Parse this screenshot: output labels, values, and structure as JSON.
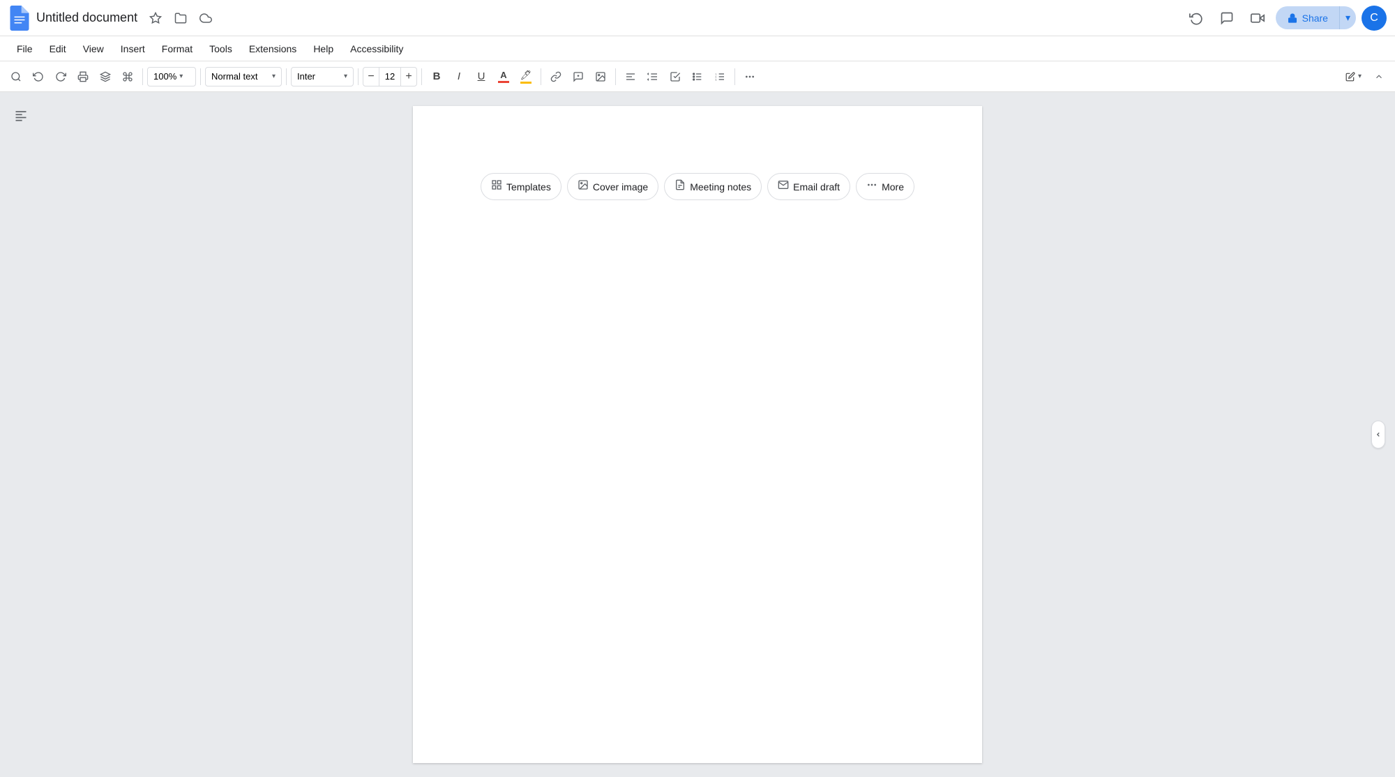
{
  "title_bar": {
    "doc_title": "Untitled document",
    "star_icon": "★",
    "folder_icon": "📁",
    "cloud_icon": "☁",
    "history_icon": "↺",
    "comments_icon": "💬",
    "meeting_icon": "📷",
    "share_label": "Share",
    "share_arrow": "▾",
    "avatar_letter": "C"
  },
  "menu_bar": {
    "items": [
      "File",
      "Edit",
      "View",
      "Insert",
      "Format",
      "Tools",
      "Extensions",
      "Help",
      "Accessibility"
    ]
  },
  "toolbar": {
    "zoom_value": "100%",
    "style_label": "Normal text",
    "font_label": "Inter",
    "font_size": "12",
    "bold_label": "B",
    "italic_label": "I",
    "underline_label": "U",
    "more_icon": "⋯"
  },
  "chips": [
    {
      "id": "templates",
      "icon": "⊞",
      "label": "Templates"
    },
    {
      "id": "cover-image",
      "icon": "🖼",
      "label": "Cover image"
    },
    {
      "id": "meeting-notes",
      "icon": "📄",
      "label": "Meeting notes"
    },
    {
      "id": "email-draft",
      "icon": "✉",
      "label": "Email draft"
    },
    {
      "id": "more",
      "icon": "⊕",
      "label": "More"
    }
  ]
}
